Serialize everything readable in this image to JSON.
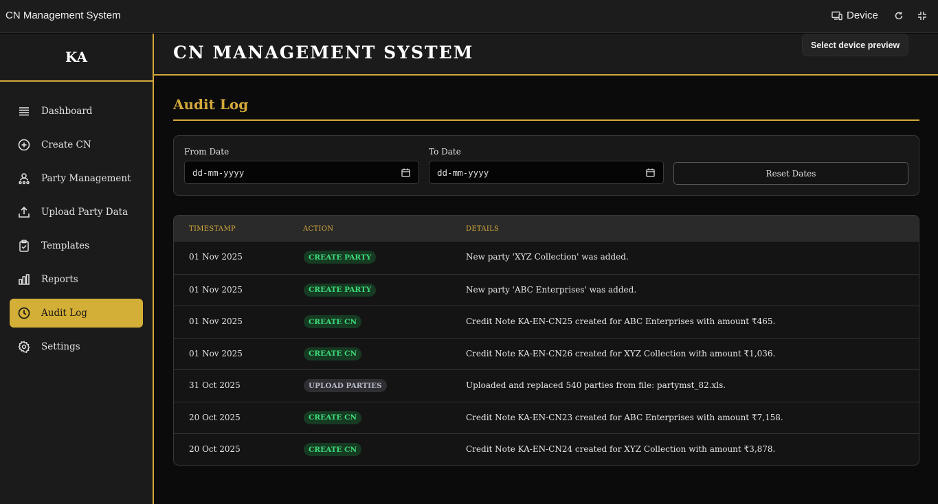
{
  "topbar": {
    "app_title": "CN Management System",
    "device_label": "Device",
    "tooltip": "Select device preview"
  },
  "sidebar": {
    "brand": "KA",
    "items": [
      {
        "label": "Dashboard",
        "icon": "list-icon",
        "active": false
      },
      {
        "label": "Create CN",
        "icon": "plus-circle-icon",
        "active": false
      },
      {
        "label": "Party Management",
        "icon": "user-network-icon",
        "active": false
      },
      {
        "label": "Upload Party Data",
        "icon": "upload-icon",
        "active": false
      },
      {
        "label": "Templates",
        "icon": "clipboard-check-icon",
        "active": false
      },
      {
        "label": "Reports",
        "icon": "bar-chart-icon",
        "active": false
      },
      {
        "label": "Audit Log",
        "icon": "clock-icon",
        "active": true
      },
      {
        "label": "Settings",
        "icon": "gear-icon",
        "active": false
      }
    ]
  },
  "header": {
    "title": "CN MANAGEMENT SYSTEM"
  },
  "page": {
    "title": "Audit Log"
  },
  "filters": {
    "from_label": "From Date",
    "from_value": "dd-mm-yyyy",
    "to_label": "To Date",
    "to_value": "dd-mm-yyyy",
    "reset_label": "Reset Dates"
  },
  "table": {
    "columns": [
      "TIMESTAMP",
      "ACTION",
      "DETAILS"
    ],
    "rows": [
      {
        "timestamp": "01 Nov 2025",
        "action": "CREATE PARTY",
        "details": "New party 'XYZ Collection' was added."
      },
      {
        "timestamp": "01 Nov 2025",
        "action": "CREATE PARTY",
        "details": "New party 'ABC Enterprises' was added."
      },
      {
        "timestamp": "01 Nov 2025",
        "action": "CREATE CN",
        "details": "Credit Note KA-EN-CN25 created for ABC Enterprises with amount ₹465."
      },
      {
        "timestamp": "01 Nov 2025",
        "action": "CREATE CN",
        "details": "Credit Note KA-EN-CN26 created for XYZ Collection with amount ₹1,036."
      },
      {
        "timestamp": "31 Oct 2025",
        "action": "UPLOAD PARTIES",
        "details": "Uploaded and replaced 540 parties from file: partymst_82.xls."
      },
      {
        "timestamp": "20 Oct 2025",
        "action": "CREATE CN",
        "details": "Credit Note KA-EN-CN23 created for ABC Enterprises with amount ₹7,158."
      },
      {
        "timestamp": "20 Oct 2025",
        "action": "CREATE CN",
        "details": "Credit Note KA-EN-CN24 created for XYZ Collection with amount ₹3,878."
      }
    ]
  },
  "colors": {
    "accent": "#d4a93a",
    "badge_green_bg": "#163a22",
    "badge_green_text": "#3ddc7a",
    "badge_grey_bg": "#2e2e33",
    "badge_grey_text": "#b5b8c2"
  }
}
